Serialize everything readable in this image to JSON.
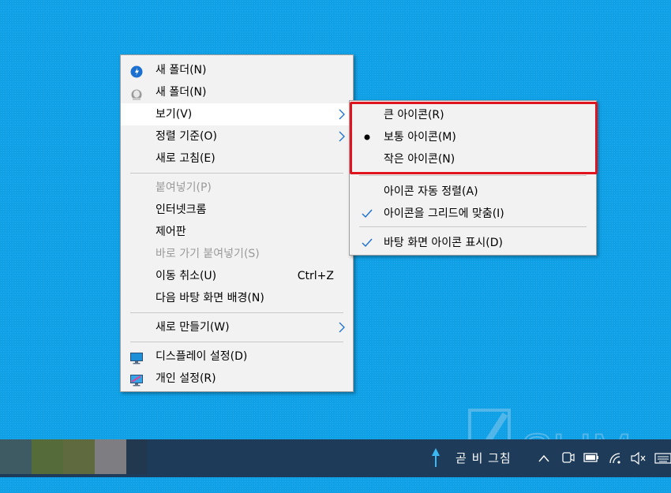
{
  "main_menu": {
    "items": [
      {
        "label": "새 폴더(N)",
        "icon": "blue-download-icon"
      },
      {
        "label": "새 폴더(N)",
        "icon": "gray-avatar-icon"
      },
      {
        "label": "보기(V)",
        "has_submenu": true,
        "highlighted": true
      },
      {
        "label": "정렬 기준(O)",
        "has_submenu": true
      },
      {
        "label": "새로 고침(E)"
      },
      {
        "label": "붙여넣기(P)",
        "disabled": true
      },
      {
        "label": "인터넷크롬"
      },
      {
        "label": "제어판"
      },
      {
        "label": "바로 가기 붙여넣기(S)",
        "disabled": true
      },
      {
        "label": "이동 취소(U)",
        "shortcut": "Ctrl+Z"
      },
      {
        "label": "다음 바탕 화면 배경(N)"
      },
      {
        "label": "새로 만들기(W)",
        "has_submenu": true
      },
      {
        "label": "디스플레이 설정(D)",
        "icon": "display-settings-icon"
      },
      {
        "label": "개인 설정(R)",
        "icon": "personalize-icon"
      }
    ]
  },
  "view_submenu": {
    "items": [
      {
        "label": "큰 아이콘(R)"
      },
      {
        "label": "보통 아이콘(M)",
        "mark": "bullet"
      },
      {
        "label": "작은 아이콘(N)"
      },
      {
        "label": "아이콘 자동 정렬(A)"
      },
      {
        "label": "아이콘을 그리드에 맞춤(I)",
        "mark": "check"
      },
      {
        "label": "바탕 화면 아이콘 표시(D)",
        "mark": "check"
      }
    ]
  },
  "taskbar": {
    "tray_app_label": "곧 비 그침"
  },
  "colors": {
    "desktop": "#0fa0e6",
    "highlight_box": "#e0141e",
    "menu_bg": "#f2f2f2",
    "taskbar": "#1e3b5a"
  }
}
